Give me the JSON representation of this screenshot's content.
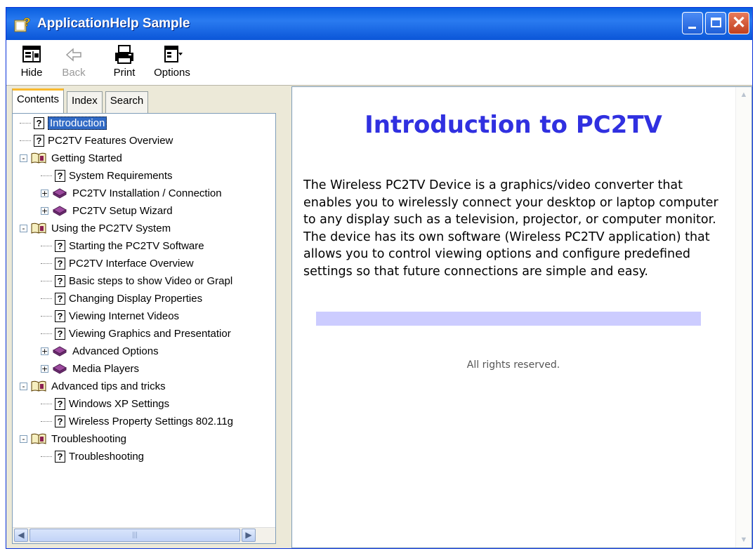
{
  "window": {
    "title": "ApplicationHelp Sample",
    "icon": "help-app-icon",
    "controls": [
      "minimize-icon",
      "maximize-icon",
      "close-icon"
    ]
  },
  "toolbar": {
    "hide_label": "Hide",
    "back_label": "Back",
    "print_label": "Print",
    "options_label": "Options"
  },
  "tabs": {
    "contents": "Contents",
    "index": "Index",
    "search": "Search",
    "active": "Contents"
  },
  "tree": [
    {
      "label": "Introduction",
      "type": "page",
      "level": 0,
      "selected": true
    },
    {
      "label": "PC2TV Features Overview",
      "type": "page",
      "level": 0
    },
    {
      "label": "Getting Started",
      "type": "book-open",
      "level": 0,
      "toggle": "-"
    },
    {
      "label": "System Requirements",
      "type": "page",
      "level": 1
    },
    {
      "label": "PC2TV Installation / Connection",
      "type": "book-closed",
      "level": 1,
      "toggle": "+"
    },
    {
      "label": "PC2TV Setup Wizard",
      "type": "book-closed",
      "level": 1,
      "toggle": "+"
    },
    {
      "label": "Using the PC2TV System",
      "type": "book-open",
      "level": 0,
      "toggle": "-"
    },
    {
      "label": "Starting the PC2TV Software",
      "type": "page",
      "level": 1
    },
    {
      "label": "PC2TV Interface Overview",
      "type": "page",
      "level": 1
    },
    {
      "label": "Basic steps to show Video or Grapl",
      "type": "page",
      "level": 1
    },
    {
      "label": "Changing Display Properties",
      "type": "page",
      "level": 1
    },
    {
      "label": "Viewing Internet Videos",
      "type": "page",
      "level": 1
    },
    {
      "label": "Viewing Graphics and Presentatior",
      "type": "page",
      "level": 1
    },
    {
      "label": "Advanced Options",
      "type": "book-closed",
      "level": 1,
      "toggle": "+"
    },
    {
      "label": "Media Players",
      "type": "book-closed",
      "level": 1,
      "toggle": "+"
    },
    {
      "label": "Advanced tips and tricks",
      "type": "book-open",
      "level": 0,
      "toggle": "-"
    },
    {
      "label": "Windows XP Settings",
      "type": "page",
      "level": 1
    },
    {
      "label": "Wireless Property Settings 802.11g",
      "type": "page",
      "level": 1
    },
    {
      "label": "Troubleshooting",
      "type": "book-open",
      "level": 0,
      "toggle": "-"
    },
    {
      "label": "Troubleshooting",
      "type": "page",
      "level": 1
    }
  ],
  "topic": {
    "title": "Introduction to PC2TV",
    "body": "The Wireless PC2TV Device is a graphics/video converter that enables you to wirelessly connect your desktop or laptop computer to any display such as a television, projector, or computer monitor. The device has its own software (Wireless PC2TV application) that allows you to control viewing options and configure predefined settings so that future connections are simple and easy.",
    "footer": "All rights reserved.",
    "title_color": "#3030E0",
    "bar_color": "#CCCCFF"
  },
  "colors": {
    "titlebar": "#0A5FE0",
    "selection": "#316AC5",
    "chrome": "#ECE9D8"
  }
}
